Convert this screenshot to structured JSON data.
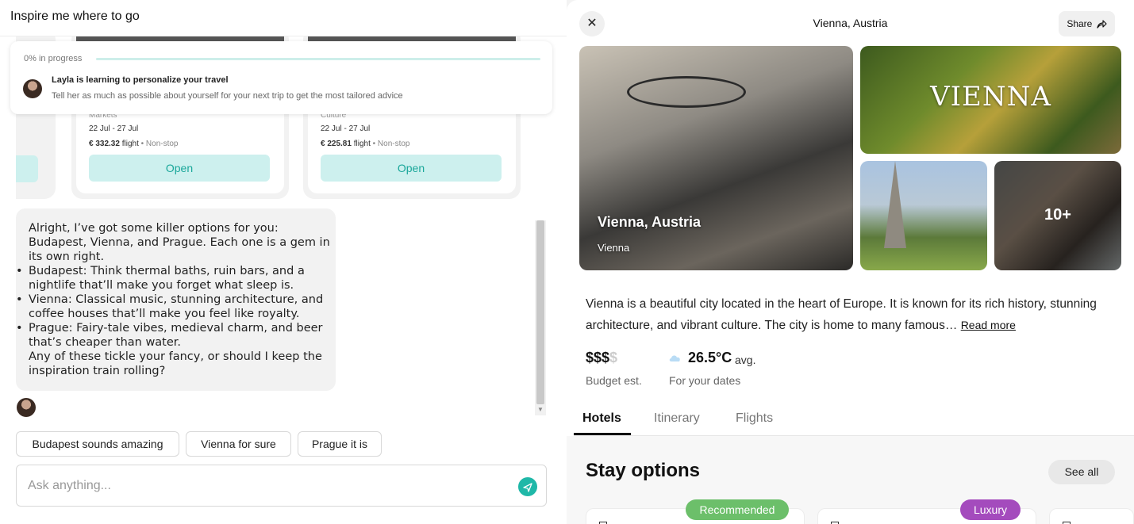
{
  "left_panel": {
    "title": "Inspire me where to go",
    "progress": {
      "label": "0% in progress",
      "value": 0,
      "title": "Layla is learning to personalize your travel",
      "subtitle": "Tell her as much as possible about yourself for your next trip to get the most tailored advice"
    },
    "cards": [
      {
        "category": "Markets",
        "dates": "22 Jul - 27 Jul",
        "price": "€ 332.32",
        "price_unit": "flight",
        "stops": "• Non-stop",
        "button": "Open"
      },
      {
        "category": "Culture",
        "dates": "22 Jul - 27 Jul",
        "price": "€ 225.81",
        "price_unit": "flight",
        "stops": "• Non-stop",
        "button": "Open"
      }
    ],
    "message": {
      "intro": "Alright, I’ve got some killer options for you: Budapest, Vienna, and Prague. Each one is a gem in its own right.",
      "bullets": [
        "Budapest: Think thermal baths, ruin bars, and a nightlife that’ll make you forget what sleep is.",
        "Vienna: Classical music, stunning architecture, and coffee houses that’ll make you feel like royalty.",
        "Prague: Fairy-tale vibes, medieval charm, and beer that’s cheaper than water."
      ],
      "outro": "Any of these tickle your fancy, or should I keep the inspiration train rolling?"
    },
    "suggestions": [
      "Budapest sounds amazing",
      "Vienna for sure",
      "Prague it is"
    ],
    "input_placeholder": "Ask anything..."
  },
  "right_panel": {
    "title": "Vienna, Austria",
    "share_label": "Share",
    "close_icon": "close-icon",
    "share_icon": "share-arrow-icon",
    "hero": {
      "title": "Vienna, Austria",
      "subtitle": "Vienna"
    },
    "sign_text": "VIENNA",
    "more_photos": "10+",
    "description": "Vienna is a beautiful city located in the heart of Europe. It is known for its rich history, stunning architecture, and vibrant culture. The city is home to many famous…",
    "read_more": "Read more",
    "budget": {
      "value": "$$$",
      "dim": "$",
      "label": "Budget est."
    },
    "weather": {
      "icon": "cloud-icon",
      "temp": "26.5°C",
      "unit": "avg.",
      "label": "For your dates"
    },
    "tabs": [
      "Hotels",
      "Itinerary",
      "Flights"
    ],
    "active_tab": "Hotels",
    "stay": {
      "title": "Stay options",
      "see_all": "See all"
    },
    "badges": [
      {
        "label": "Recommended",
        "color": "#6cbf6a"
      },
      {
        "label": "Luxury",
        "color": "#a44bbd"
      }
    ]
  },
  "colors": {
    "accent": "#1aa79a",
    "button_bg": "#cdf0ee",
    "send": "#1fb8a8"
  }
}
